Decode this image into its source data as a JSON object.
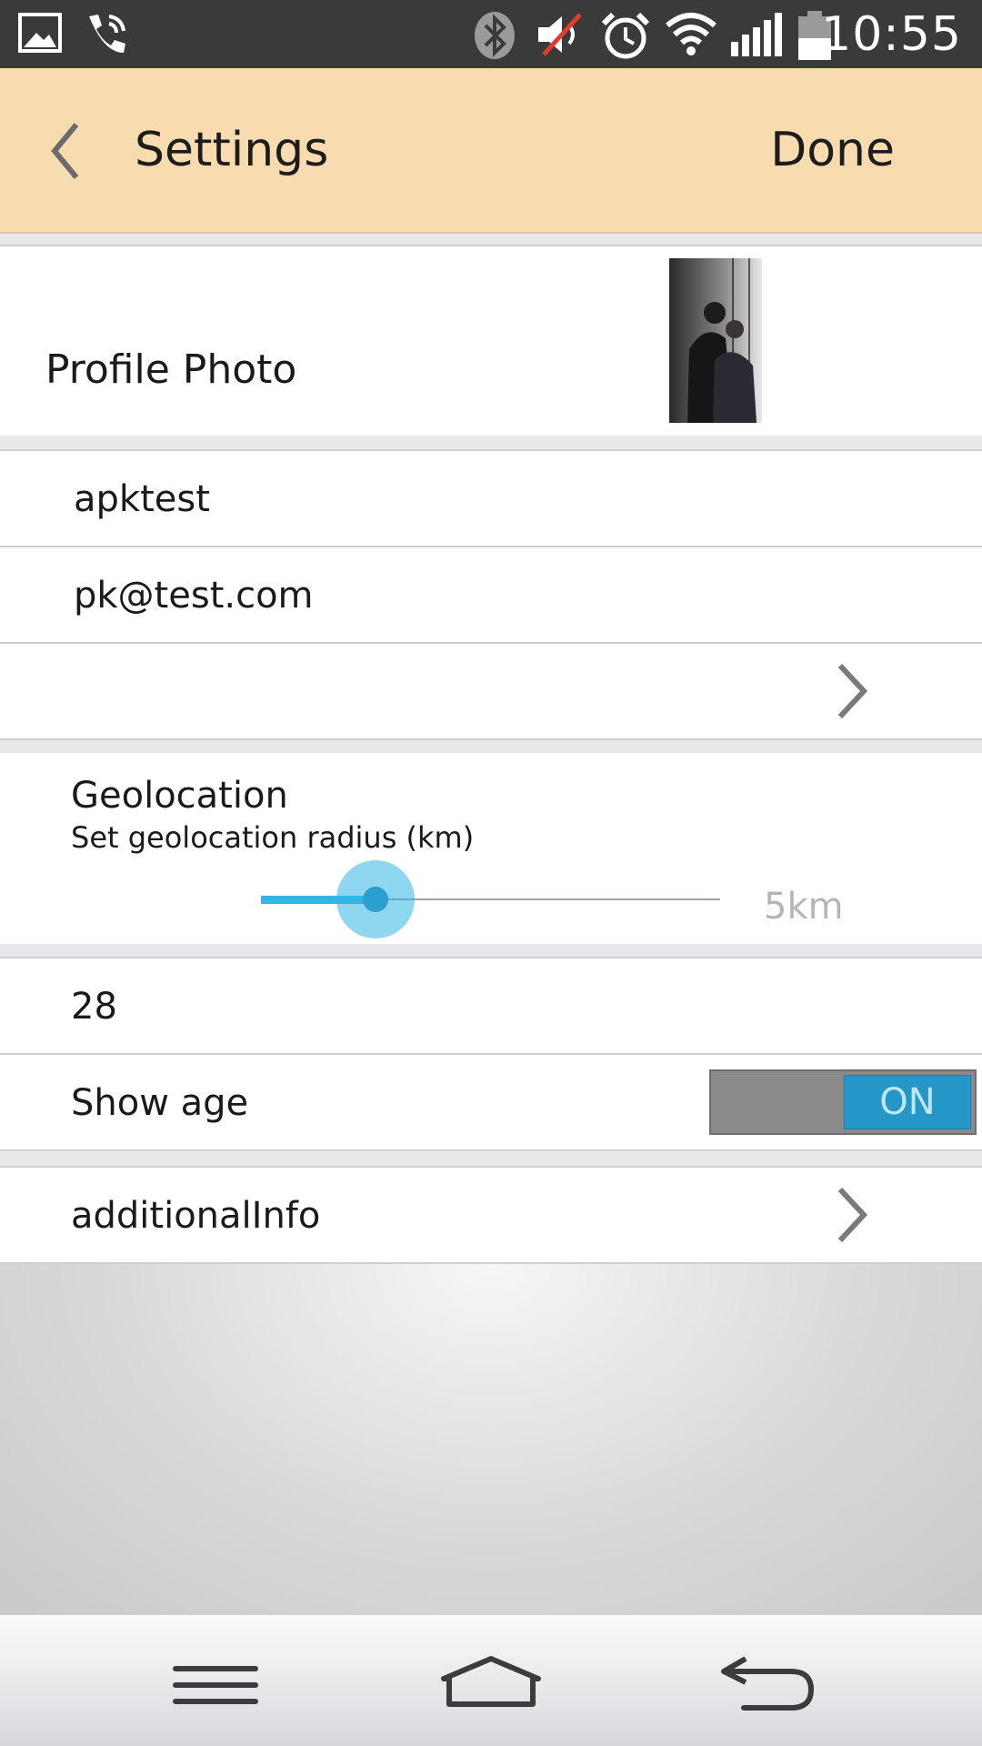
{
  "status_bar": {
    "time": "10:55",
    "icons": [
      "gallery-icon",
      "phone-icon",
      "bluetooth-icon",
      "muted-icon",
      "alarm-icon",
      "wifi-icon",
      "signal-icon",
      "battery-icon"
    ]
  },
  "header": {
    "title": "Settings",
    "done_label": "Done"
  },
  "profile": {
    "label": "Profile Photo"
  },
  "fields": {
    "username": "apktest",
    "email": "pk@test.com"
  },
  "geolocation": {
    "title": "Geolocation",
    "subtitle": "Set geolocation radius (km)",
    "value_label": "5km",
    "slider_fraction": 0.25
  },
  "age": {
    "value": "28",
    "show_age_label": "Show age",
    "toggle_label": "ON"
  },
  "additional": {
    "label": "additionalInfo"
  },
  "colors": {
    "accent": "#33b5e5",
    "header_bg": "#f8dcaf"
  }
}
